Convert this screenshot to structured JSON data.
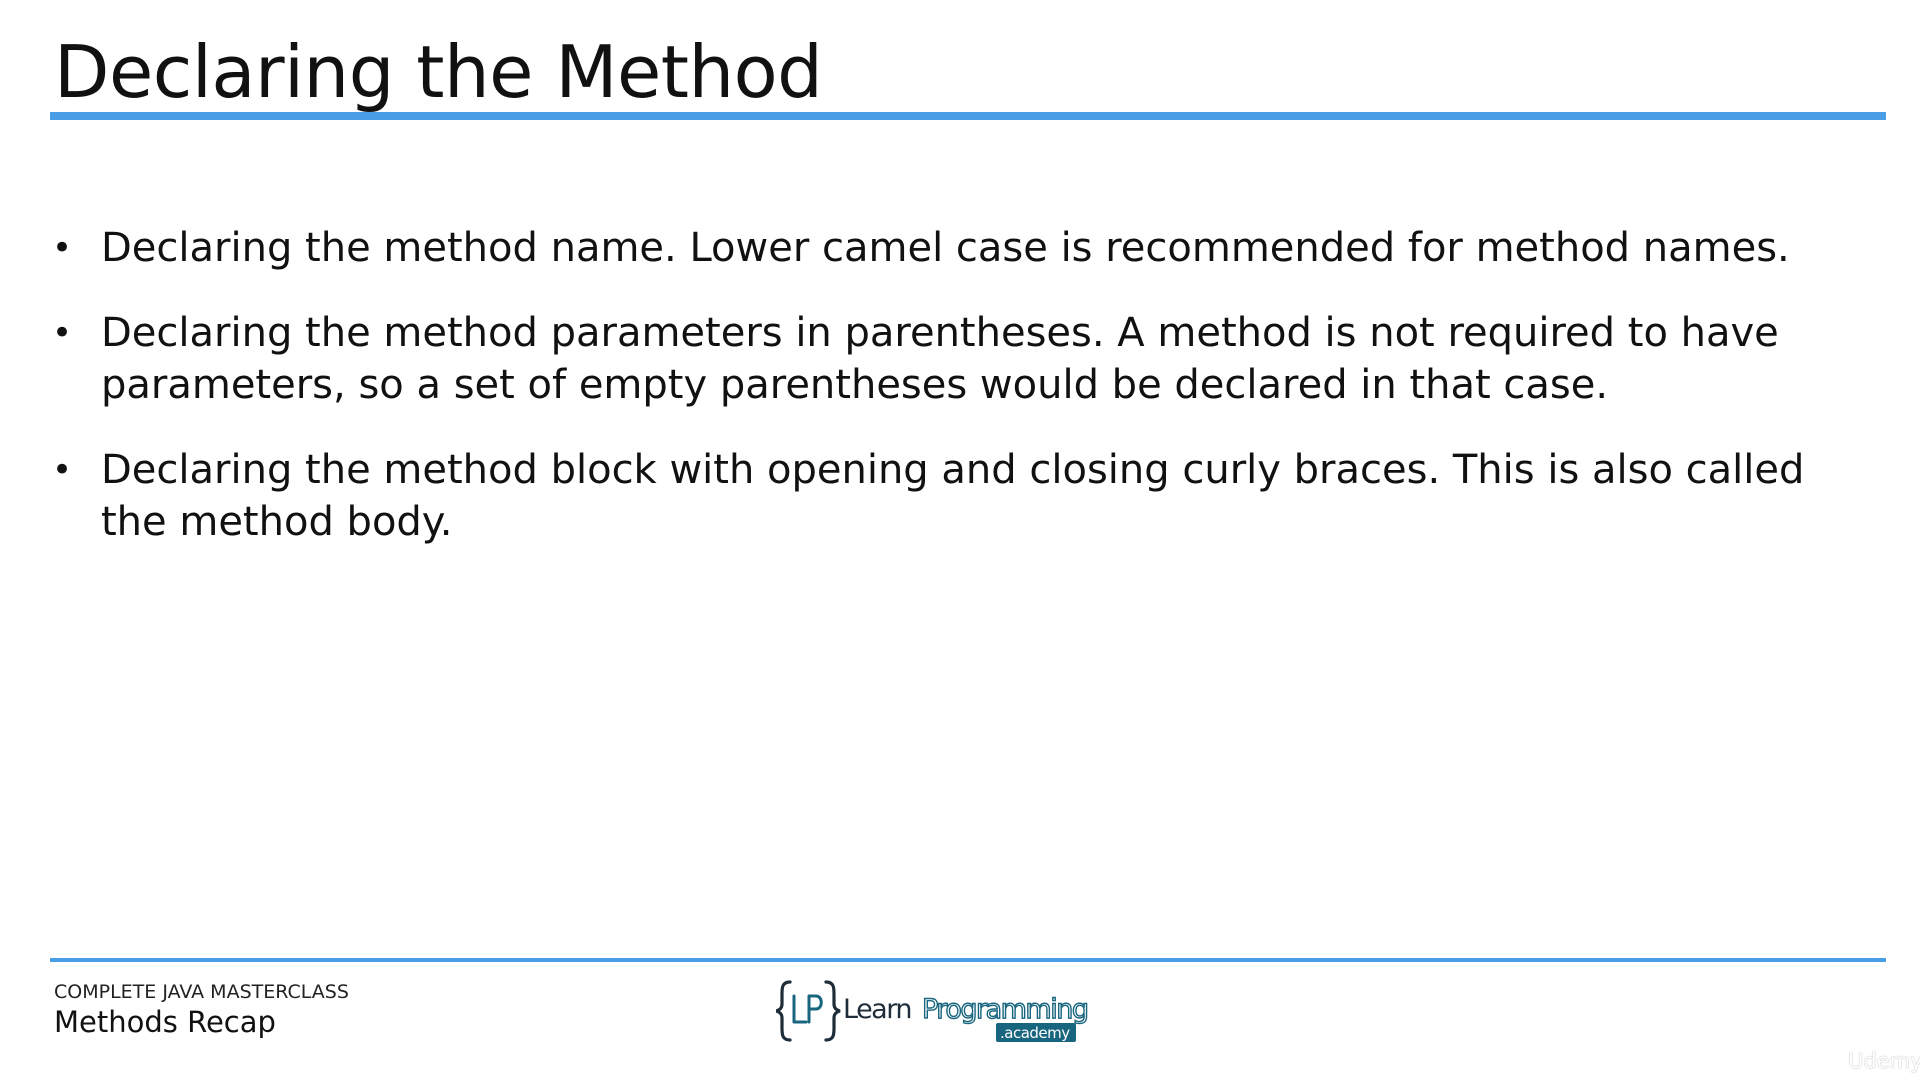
{
  "slide": {
    "title": "Declaring the Method",
    "bullets": [
      {
        "marker": "•",
        "text": "Declaring the method name. Lower camel case is recommended for method names."
      },
      {
        "marker": "•",
        "text": "Declaring the method parameters in parentheses. A method is not required to have parameters, so a set of empty parentheses would be declared in that case."
      },
      {
        "marker": "•",
        "text": "Declaring the method block with opening and closing curly braces. This is also called the method body."
      }
    ]
  },
  "footer": {
    "course": "COMPLETE JAVA MASTERCLASS",
    "section": "Methods Recap"
  },
  "logo": {
    "text": "{LP}LearnProgramming.academy",
    "icon": "learnprogramming-academy-logo"
  },
  "watermark": {
    "text": "Udemy"
  },
  "colors": {
    "accent_rule": "#4a9ee8",
    "logo_teal": "#17657e",
    "logo_dark": "#1f2d3a",
    "text": "#111111"
  }
}
